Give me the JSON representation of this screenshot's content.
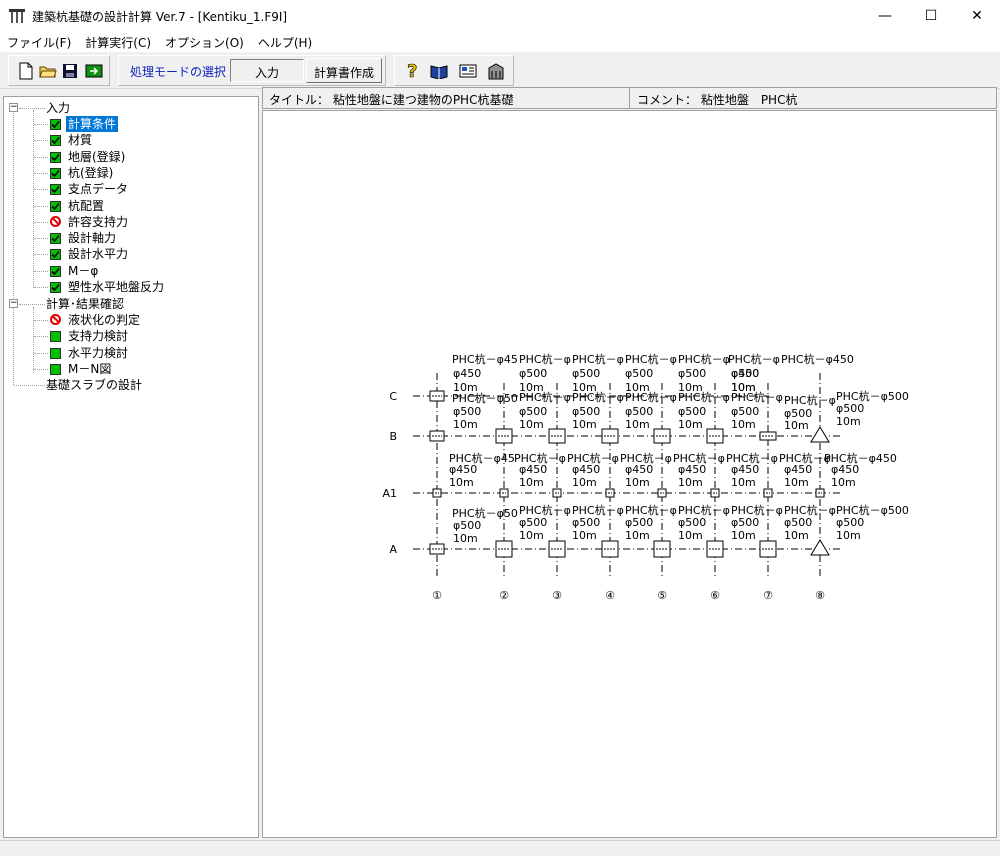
{
  "window": {
    "title": "建築杭基礎の設計計算 Ver.7 - [Kentiku_1.F9I]",
    "minimize": "—",
    "maximize": "☐",
    "close": "✕"
  },
  "menu": [
    "ファイル(F)",
    "計算実行(C)",
    "オプション(O)",
    "ヘルプ(H)"
  ],
  "toolbar": {
    "mode_label": "処理モードの選択",
    "mode_value": "入力",
    "report_button": "計算書作成",
    "icons": [
      "new-file-icon",
      "open-folder-icon",
      "save-icon",
      "export-icon",
      "help-icon",
      "book-icon",
      "card-icon",
      "building-icon"
    ]
  },
  "tree": {
    "input_root": "入力",
    "input_items": [
      {
        "label": "計算条件",
        "status": "checked",
        "selected": true
      },
      {
        "label": "材質",
        "status": "checked"
      },
      {
        "label": "地層(登録)",
        "status": "checked"
      },
      {
        "label": "杭(登録)",
        "status": "checked"
      },
      {
        "label": "支点データ",
        "status": "checked"
      },
      {
        "label": "杭配置",
        "status": "checked"
      },
      {
        "label": "許容支持力",
        "status": "prohibited"
      },
      {
        "label": "設計軸力",
        "status": "checked"
      },
      {
        "label": "設計水平力",
        "status": "checked"
      },
      {
        "label": "M－φ",
        "status": "checked"
      },
      {
        "label": "塑性水平地盤反力",
        "status": "checked"
      }
    ],
    "calc_root": "計算･結果確認",
    "calc_items": [
      {
        "label": "液状化の判定",
        "status": "prohibited"
      },
      {
        "label": "支持力検討",
        "status": "green"
      },
      {
        "label": "水平力検討",
        "status": "green"
      },
      {
        "label": "M－N図",
        "status": "green"
      }
    ],
    "slab_root": "基礎スラブの設計"
  },
  "info": {
    "title": "タイトル： 粘性地盤に建つ建物のPHC杭基礎",
    "comment": "コメント： 粘性地盤　PHC杭"
  },
  "plan": {
    "rows": [
      "C",
      "B",
      "A1",
      "A"
    ],
    "cols": [
      "①",
      "②",
      "③",
      "④",
      "⑤",
      "⑥",
      "⑦",
      "⑧"
    ],
    "labels": {
      "c_top": [
        "PHC杭－φ45",
        "PHC杭－φ",
        "PHC杭－φ",
        "PHC杭－φ",
        "PHC杭－φ",
        "PHC杭－φ",
        "PHC杭－φ450"
      ],
      "c_dia": [
        "φ450",
        "φ500",
        "φ500",
        "φ500",
        "φ500",
        "φ500",
        "φ450"
      ],
      "len": "10m",
      "b_top": [
        "PHC杭－φ50",
        "PHC杭－φ",
        "PHC杭－φ",
        "PHC杭－φ",
        "PHC杭－φ",
        "PHC杭－φ",
        "PHC杭－φ",
        "PHC杭－φ",
        "PHC杭－φ500"
      ],
      "b_dia": [
        "φ500",
        "φ500",
        "φ500",
        "φ500",
        "φ500",
        "φ500",
        "φ500",
        "φ500"
      ],
      "a1_top": [
        "PHC杭－φ45",
        "PHC杭－φ",
        "PHC杭－φ",
        "PHC杭－φ",
        "PHC杭－φ",
        "PHC杭－φ",
        "PHC杭－φ",
        "PHC杭－φ450"
      ],
      "a1_dia": [
        "φ450",
        "φ450",
        "φ450",
        "φ450",
        "φ450",
        "φ450",
        "φ450",
        "φ450"
      ],
      "a_top": [
        "PHC杭－φ50",
        "PHC杭－φ",
        "PHC杭－φ",
        "PHC杭－φ",
        "PHC杭－φ",
        "PHC杭－φ",
        "PHC杭－φ",
        "PHC杭－φ500"
      ],
      "a_dia": [
        "φ500",
        "φ500",
        "φ500",
        "φ500",
        "φ500",
        "φ500",
        "φ500",
        "φ500"
      ]
    }
  }
}
